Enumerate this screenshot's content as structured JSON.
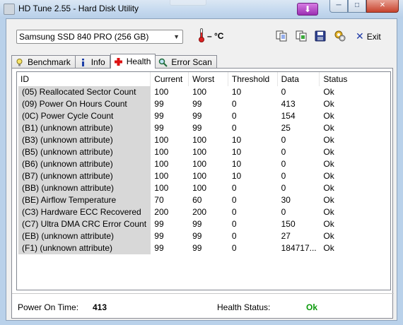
{
  "window": {
    "title": "HD Tune 2.55 - Hard Disk Utility",
    "minimize": "─",
    "maximize": "□",
    "close": "✕",
    "favorite_glyph": "⬇"
  },
  "toolbar": {
    "drive": "Samsung SSD 840 PRO (256 GB)",
    "temperature": "– °C",
    "exit_label": "Exit"
  },
  "tabs": [
    {
      "label": "Benchmark",
      "icon": "lightbulb-icon"
    },
    {
      "label": "Info",
      "icon": "info-icon"
    },
    {
      "label": "Health",
      "icon": "health-cross-icon",
      "active": true
    },
    {
      "label": "Error Scan",
      "icon": "magnifier-icon"
    }
  ],
  "table": {
    "columns": [
      "ID",
      "Current",
      "Worst",
      "Threshold",
      "Data",
      "Status"
    ],
    "rows": [
      [
        "(05) Reallocated Sector Count",
        "100",
        "100",
        "10",
        "0",
        "Ok"
      ],
      [
        "(09) Power On Hours Count",
        "99",
        "99",
        "0",
        "413",
        "Ok"
      ],
      [
        "(0C) Power Cycle Count",
        "99",
        "99",
        "0",
        "154",
        "Ok"
      ],
      [
        "(B1) (unknown attribute)",
        "99",
        "99",
        "0",
        "25",
        "Ok"
      ],
      [
        "(B3) (unknown attribute)",
        "100",
        "100",
        "10",
        "0",
        "Ok"
      ],
      [
        "(B5) (unknown attribute)",
        "100",
        "100",
        "10",
        "0",
        "Ok"
      ],
      [
        "(B6) (unknown attribute)",
        "100",
        "100",
        "10",
        "0",
        "Ok"
      ],
      [
        "(B7) (unknown attribute)",
        "100",
        "100",
        "10",
        "0",
        "Ok"
      ],
      [
        "(BB) (unknown attribute)",
        "100",
        "100",
        "0",
        "0",
        "Ok"
      ],
      [
        "(BE) Airflow Temperature",
        "70",
        "60",
        "0",
        "30",
        "Ok"
      ],
      [
        "(C3) Hardware ECC Recovered",
        "200",
        "200",
        "0",
        "0",
        "Ok"
      ],
      [
        "(C7) Ultra DMA CRC Error Count",
        "99",
        "99",
        "0",
        "150",
        "Ok"
      ],
      [
        "(EB) (unknown attribute)",
        "99",
        "99",
        "0",
        "27",
        "Ok"
      ],
      [
        "(F1) (unknown attribute)",
        "99",
        "99",
        "0",
        "184717...",
        "Ok"
      ]
    ]
  },
  "footer": {
    "power_on_label": "Power On Time:",
    "power_on_value": "413",
    "health_label": "Health Status:",
    "health_value": "Ok",
    "health_color": "#0a9a0a"
  }
}
